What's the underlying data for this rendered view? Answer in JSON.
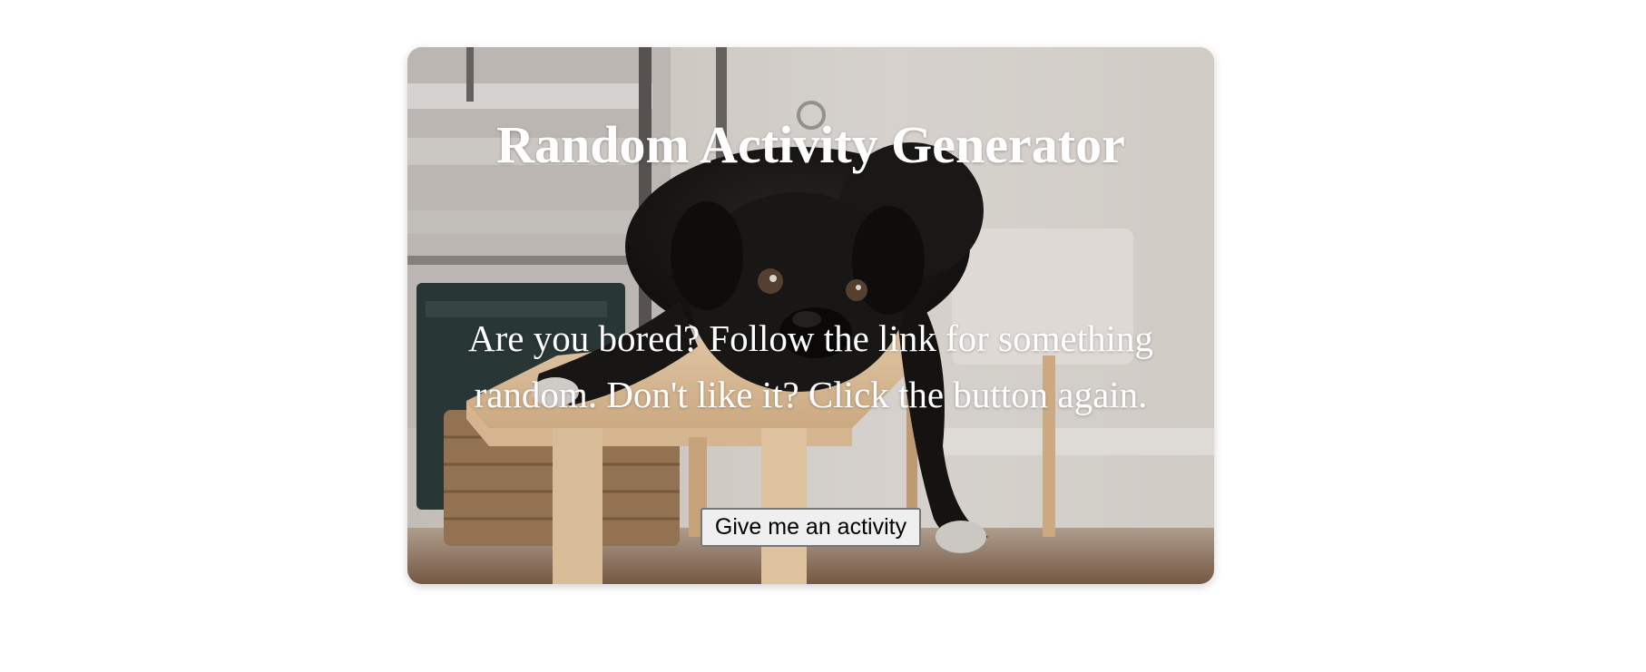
{
  "card": {
    "image_description": "black pug lying on a light wooden bench",
    "title": "Random Activity Generator",
    "description": "Are you bored? Follow the link for something random. Don't like it? Click the button again.",
    "button_label": "Give me an activity"
  },
  "colors": {
    "page_background": "#ffffff",
    "text": "#ffffff",
    "button_background": "#efefef",
    "button_border": "#767676"
  }
}
